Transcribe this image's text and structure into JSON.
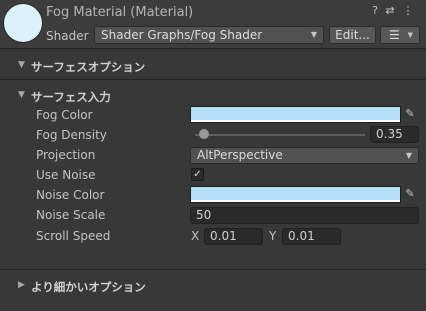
{
  "header": {
    "title": "Fog Material (Material)",
    "shader_label": "Shader",
    "shader_value": "Shader Graphs/Fog Shader",
    "edit_label": "Edit...",
    "help_icon": "?",
    "settings_icon": "⇄",
    "menu_icon": "⋮",
    "list_icon": "☰"
  },
  "sections": {
    "surface_options": "サーフェスオプション",
    "surface_inputs": "サーフェス入力",
    "advanced_options": "より細かいオプション"
  },
  "properties": {
    "fog_color": {
      "label": "Fog Color",
      "color": "#b3e0f7"
    },
    "fog_density": {
      "label": "Fog Density",
      "value": "0.35",
      "slider_fraction": 0.05
    },
    "projection": {
      "label": "Projection",
      "value": "AltPerspective"
    },
    "use_noise": {
      "label": "Use Noise",
      "checked": true,
      "check_glyph": "✓"
    },
    "noise_color": {
      "label": "Noise Color",
      "color": "#b3e0f7"
    },
    "noise_scale": {
      "label": "Noise Scale",
      "value": "50"
    },
    "scroll_speed": {
      "label": "Scroll Speed",
      "x_label": "X",
      "x_value": "0.01",
      "y_label": "Y",
      "y_value": "0.01"
    }
  },
  "glyphs": {
    "foldout_open": "▼",
    "foldout_closed": "▶",
    "dropdown_arrow": "▼",
    "eyedropper": "✎"
  }
}
